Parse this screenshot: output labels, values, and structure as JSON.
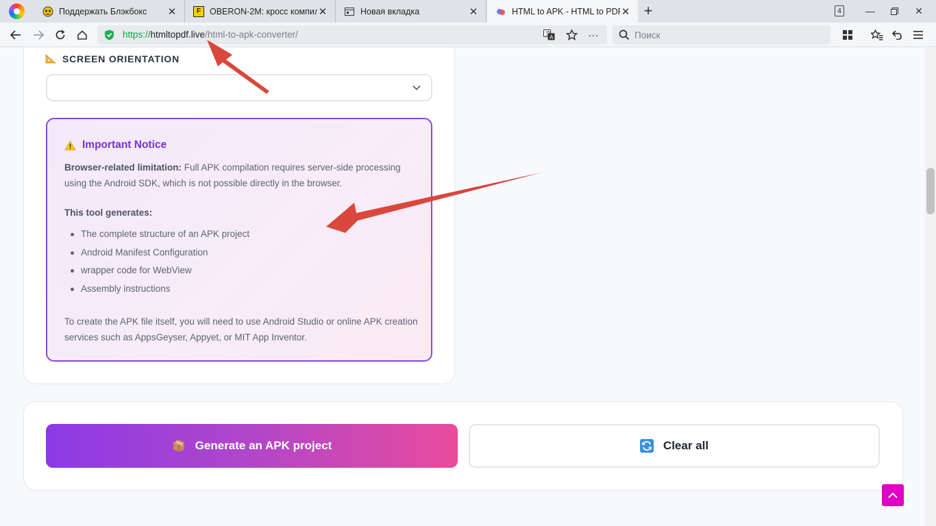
{
  "browser": {
    "tabs": [
      {
        "title": "Поддержать Блэкбокс",
        "active": false
      },
      {
        "title": "OBERON-2M: кросс компиля",
        "active": false
      },
      {
        "title": "Новая вкладка",
        "active": false
      },
      {
        "title": "HTML to APK - HTML to PDF",
        "active": true
      }
    ],
    "tab_count": "4",
    "url": {
      "scheme": "https://",
      "host": "htmltopdf.live",
      "path": "/html-to-apk-converter/"
    },
    "search_placeholder": "Поиск"
  },
  "form": {
    "orientation_label": "SCREEN ORIENTATION",
    "orientation_value": ""
  },
  "notice": {
    "title": "Important Notice",
    "limitation_label": "Browser-related limitation:",
    "limitation_text": " Full APK compilation requires server-side processing using the Android SDK, which is not possible directly in the browser.",
    "generates_title": "This tool generates:",
    "items": [
      "The complete structure of an APK project",
      "Android Manifest Configuration",
      "wrapper code for WebView",
      "Assembly instructions"
    ],
    "footer": "To create the APK file itself, you will need to use Android Studio or online APK creation services such as AppsGeyser, Appyet, or MIT App Inventor."
  },
  "actions": {
    "generate_label": "Generate an APK project",
    "clear_label": "Clear all"
  },
  "colors": {
    "accent_purple": "#8a47dc",
    "button_gradient_start": "#8b3ae6",
    "button_gradient_end": "#e94b9c",
    "back_to_top": "#e100c4",
    "annotation_arrow": "#d9473d"
  }
}
